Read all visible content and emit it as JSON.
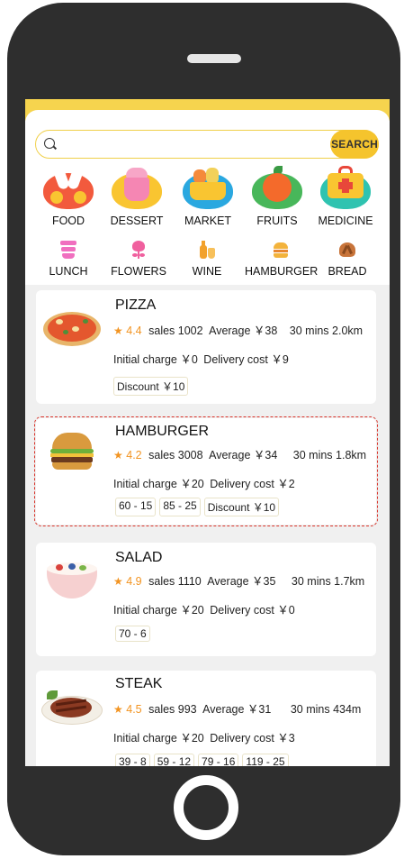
{
  "search": {
    "placeholder": "",
    "button_label": "SEARCH"
  },
  "categories_main": [
    {
      "label": "FOOD",
      "icon": "food-icon",
      "color": "#f25a3d"
    },
    {
      "label": "DESSERT",
      "icon": "dessert-icon",
      "color": "#f9c531"
    },
    {
      "label": "MARKET",
      "icon": "market-icon",
      "color": "#2aa8e0"
    },
    {
      "label": "FRUITS",
      "icon": "fruits-icon",
      "color": "#48b75a"
    },
    {
      "label": "MEDICINE",
      "icon": "medicine-icon",
      "color": "#2fc3b0"
    }
  ],
  "categories_secondary": [
    {
      "label": "LUNCH",
      "icon": "lunch-icon",
      "color": "#f06fbf"
    },
    {
      "label": "FLOWERS",
      "icon": "flowers-icon",
      "color": "#f0609e"
    },
    {
      "label": "WINE",
      "icon": "wine-icon",
      "color": "#f2a12b"
    },
    {
      "label": "HAMBURGER",
      "icon": "hamburger-icon",
      "color": "#f3b33c"
    },
    {
      "label": "BREAD",
      "icon": "bread-icon",
      "color": "#c8743a"
    }
  ],
  "restaurants": [
    {
      "name": "PIZZA",
      "rating": "4.4",
      "sales": "sales 1002",
      "average": "Average ￥38",
      "time_distance": "30 mins  2.0km",
      "initial_charge": "Initial charge ￥0",
      "delivery_cost": "Delivery cost ￥9",
      "tags": [
        "Discount ￥10"
      ]
    },
    {
      "name": "HAMBURGER",
      "rating": "4.2",
      "sales": "sales 3008",
      "average": "Average ￥34",
      "time_distance": "30 mins  1.8km",
      "initial_charge": "Initial charge ￥20",
      "delivery_cost": "Delivery cost ￥2",
      "tags": [
        "60 - 15",
        "85 - 25",
        "Discount ￥10"
      ]
    },
    {
      "name": "SALAD",
      "rating": "4.9",
      "sales": "sales 1110",
      "average": "Average ￥35",
      "time_distance": "30 mins  1.7km",
      "initial_charge": "Initial charge ￥20",
      "delivery_cost": "Delivery cost ￥0",
      "tags": [
        "70 - 6"
      ]
    },
    {
      "name": "STEAK",
      "rating": "4.5",
      "sales": "sales 993",
      "average": "Average ￥31",
      "time_distance": "30 mins  434m",
      "initial_charge": "Initial charge ￥20",
      "delivery_cost": "Delivery cost ￥3",
      "tags": [
        "39 - 8",
        "59 - 12",
        "79 - 16",
        "119 - 25"
      ]
    }
  ],
  "colors": {
    "accent": "#f5c42d",
    "rating": "#f29422",
    "selection": "#d9342b"
  }
}
